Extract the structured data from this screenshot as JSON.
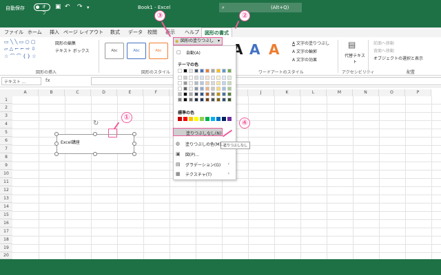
{
  "titlebar": {
    "autosave_label": "自動保存",
    "toggle_state": "オフ",
    "doc_title": "Book1 - Excel",
    "search_placeholder": "(Alt+Q)"
  },
  "tabs": [
    "ファイル",
    "ホーム",
    "挿入",
    "ページ レイアウト",
    "数式",
    "データ",
    "校閲",
    "表示",
    "ヘルプ",
    "図形の書式"
  ],
  "active_tab": "図形の書式",
  "ribbon": {
    "edit_shape": "図形の編集",
    "text_box": "テキスト ボックス",
    "group_insert": "図形の挿入",
    "style_label": "Abc",
    "group_styles": "図形のスタイル",
    "fill_button": "図形の塗りつぶし",
    "text_fill": "文字の塗りつぶし",
    "text_outline": "文字の輪郭",
    "text_effect": "文字の効果",
    "group_wordart": "ワードアートのスタイル",
    "alt_text": "代替テキスト",
    "group_accessibility": "アクセシビリティ",
    "bring_forward": "前面へ移動",
    "send_backward": "背面へ移動",
    "selection_pane": "オブジェクトの選択と表示",
    "group_arrange": "配置",
    "wordart_letter": "A"
  },
  "formula_bar": {
    "name_box": "テキスト ...",
    "fx": "fx"
  },
  "columns": [
    "A",
    "B",
    "C",
    "D",
    "E",
    "F",
    "G",
    "H",
    "I",
    "J",
    "K",
    "L",
    "M",
    "N",
    "O",
    "P"
  ],
  "rows": [
    "1",
    "2",
    "3",
    "4",
    "5",
    "6",
    "7",
    "8",
    "9",
    "10",
    "11",
    "12",
    "13",
    "14",
    "15",
    "16",
    "17",
    "18",
    "19",
    "20"
  ],
  "shape_text": "Excel講座",
  "dropdown": {
    "auto": "自動(A)",
    "theme_colors": "テーマの色",
    "standard_colors": "標準の色",
    "no_fill": "塗りつぶしなし(N)",
    "more_colors": "塗りつぶしの色(M)...",
    "picture": "図(P)...",
    "gradient": "グラデーション(G)",
    "texture": "テクスチャ(T)",
    "tooltip": "塗りつぶしなし"
  },
  "badges": [
    "①",
    "②",
    "③",
    "④"
  ],
  "theme_palette": [
    "#ffffff",
    "#000000",
    "#e7e6e6",
    "#44546a",
    "#4472c4",
    "#ed7d31",
    "#a5a5a5",
    "#ffc000",
    "#5b9bd5",
    "#70ad47"
  ],
  "standard_palette": [
    "#c00000",
    "#ff0000",
    "#ffc000",
    "#ffff00",
    "#92d050",
    "#00b050",
    "#00b0f0",
    "#0070c0",
    "#002060",
    "#7030a0"
  ],
  "accent_color": "#1e7145",
  "highlight_color": "#f05a9b"
}
